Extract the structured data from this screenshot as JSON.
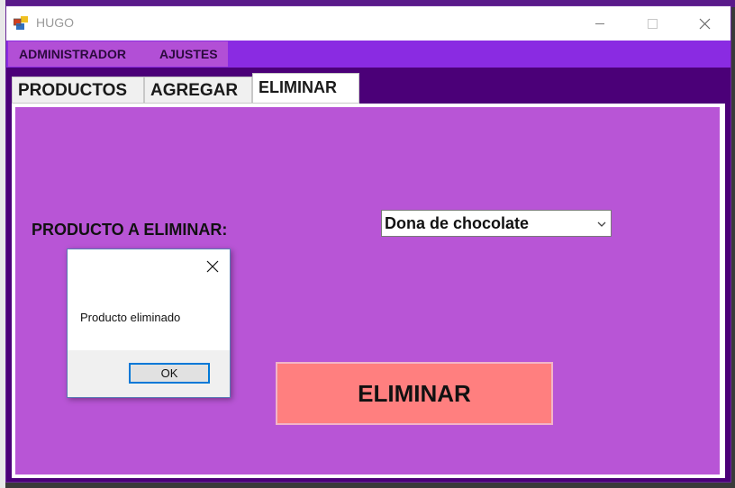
{
  "window": {
    "title": "HUGO",
    "controls": {
      "minimize": "─",
      "maximize": "☐",
      "close": "✕"
    }
  },
  "menubar": {
    "items": [
      {
        "label": "ADMINISTRADOR"
      },
      {
        "label": "AJUSTES"
      }
    ]
  },
  "tabs": [
    {
      "label": "PRODUCTOS",
      "active": false
    },
    {
      "label": "AGREGAR",
      "active": false
    },
    {
      "label": "ELIMINAR",
      "active": true
    }
  ],
  "form": {
    "product_label": "PRODUCTO A ELIMINAR:",
    "product_select_value": "Dona de chocolate",
    "delete_button_label": "ELIMINAR"
  },
  "message_box": {
    "text": "Producto eliminado",
    "ok_label": "OK"
  },
  "colors": {
    "window_bg": "#4b0078",
    "menubar": "#8a2be2",
    "content_bg": "#b855d6",
    "delete_button": "#ff7f7f"
  }
}
